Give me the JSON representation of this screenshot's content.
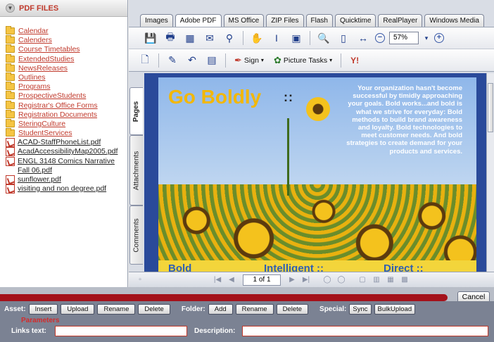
{
  "left_panel": {
    "header": "PDF FILES",
    "items": [
      {
        "kind": "folder",
        "label": "Calendar"
      },
      {
        "kind": "folder",
        "label": "Calenders"
      },
      {
        "kind": "folder",
        "label": "Course Timetables"
      },
      {
        "kind": "folder",
        "label": "ExtendedStudies"
      },
      {
        "kind": "folder",
        "label": "NewsReleases"
      },
      {
        "kind": "folder",
        "label": "Outlines"
      },
      {
        "kind": "folder",
        "label": "Programs"
      },
      {
        "kind": "folder",
        "label": "ProspectiveStudents"
      },
      {
        "kind": "folder",
        "label": "Registrar's Office Forms"
      },
      {
        "kind": "folder",
        "label": "Registration Documents"
      },
      {
        "kind": "folder",
        "label": "SteringCulture"
      },
      {
        "kind": "folder",
        "label": "StudentServices"
      },
      {
        "kind": "pdf",
        "label": "ACAD-StaffPhoneList.pdf"
      },
      {
        "kind": "pdf",
        "label": "AcadAccessibilityMap2005.pdf"
      },
      {
        "kind": "pdf",
        "label": "ENGL 3148 Comics Narrative Fall 06.pdf"
      },
      {
        "kind": "pdf",
        "label": "sunflower.pdf"
      },
      {
        "kind": "pdf",
        "label": "visiting and non degree.pdf"
      }
    ]
  },
  "tabs": [
    "Images",
    "Adobe PDF",
    "MS Office",
    "ZIP Files",
    "Flash",
    "Quicktime",
    "RealPlayer",
    "Windows Media"
  ],
  "toolbar": {
    "zoom": "57%",
    "sign_label": "Sign",
    "picture_tasks_label": "Picture Tasks"
  },
  "side_tabs": [
    "Pages",
    "Attachments",
    "Comments"
  ],
  "document": {
    "title": "Go Boldly",
    "title_dots": "::",
    "body": "Your organization hasn't become successful by timidly approaching your goals. Bold works...and bold is what we strive for everyday: Bold methods to build brand awareness and loyalty. Bold technologies to meet customer needs. And bold strategies to create demand for your products and services.",
    "bottom_words": [
      "Bold",
      "Intelligent ::",
      "Direct ::"
    ]
  },
  "nav": {
    "page_indicator": "1 of 1"
  },
  "bottom": {
    "cancel_label": "Cancel",
    "asset_label": "Asset:",
    "asset_buttons": [
      "Insert",
      "Upload",
      "Rename",
      "Delete"
    ],
    "folder_label": "Folder:",
    "folder_buttons": [
      "Add",
      "Rename",
      "Delete"
    ],
    "special_label": "Special:",
    "special_buttons": [
      "Sync",
      "BulkUpload"
    ],
    "params_title": "Parameters",
    "links_label": "Links text:",
    "desc_label": "Description:"
  },
  "colors": {
    "accent_red": "#a4121b",
    "viewer_blue": "#2a4a9a",
    "title_yellow": "#f2b705"
  }
}
